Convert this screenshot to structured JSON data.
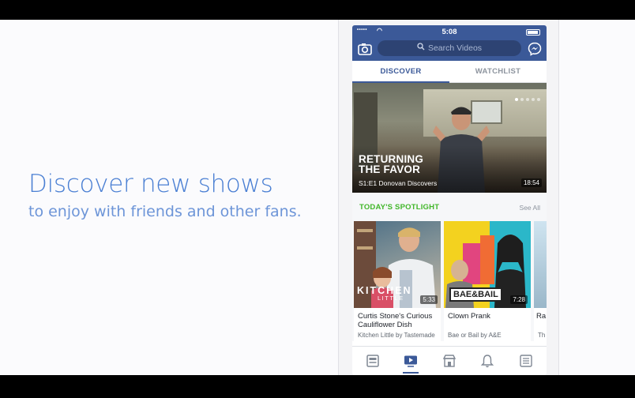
{
  "promo": {
    "headline": "Discover new shows",
    "subline": "to enjoy with friends and other fans."
  },
  "status_bar": {
    "signal": "•••••",
    "wifi": "◠",
    "time": "5:08"
  },
  "header": {
    "camera_icon": "camera-icon",
    "search_placeholder": "Search Videos",
    "messenger_icon": "messenger-icon"
  },
  "tabs": [
    {
      "label": "DISCOVER",
      "active": true
    },
    {
      "label": "WATCHLIST",
      "active": false
    }
  ],
  "hero": {
    "title": "RETURNING THE FAVOR",
    "episode": "S1:E1 Donovan Discovers",
    "duration": "18:54",
    "pager_count": 5,
    "pager_active": 1
  },
  "spotlight": {
    "title": "TODAY'S SPOTLIGHT",
    "see_all": "See All",
    "cards": [
      {
        "title": "Curtis Stone's Curious Cauliflower Dish",
        "source": "Kitchen Little by Tastemade",
        "duration": "5:33",
        "thumb_text": "KITCHEN",
        "thumb_subtext": "LITTLE"
      },
      {
        "title": "Clown Prank",
        "source": "Bae or Bail by A&E",
        "duration": "7:28",
        "thumb_text": "BAE&BAIL"
      },
      {
        "title": "Ra",
        "source": "Th Mi"
      }
    ]
  },
  "bottom_nav": [
    {
      "icon": "news-feed-icon",
      "active": false
    },
    {
      "icon": "video-icon",
      "active": true
    },
    {
      "icon": "marketplace-icon",
      "active": false
    },
    {
      "icon": "notifications-bell-icon",
      "active": false
    },
    {
      "icon": "menu-icon",
      "active": false
    }
  ],
  "colors": {
    "facebook_blue": "#3b5998",
    "spotlight_green": "#42b72a",
    "promo_text": "#4a7fd3"
  }
}
